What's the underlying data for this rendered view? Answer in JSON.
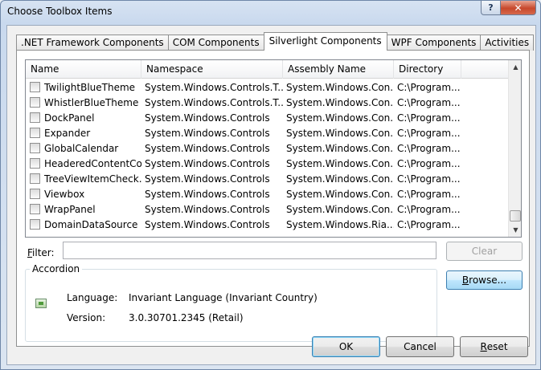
{
  "window": {
    "title": "Choose Toolbox Items",
    "help_label": "?",
    "close_label": "✕"
  },
  "tabs": [
    {
      "label": ".NET Framework Components",
      "active": false
    },
    {
      "label": "COM Components",
      "active": false
    },
    {
      "label": "Silverlight Components",
      "active": true
    },
    {
      "label": "WPF Components",
      "active": false
    },
    {
      "label": "Activities",
      "active": false
    }
  ],
  "list": {
    "columns": [
      "Name",
      "Namespace",
      "Assembly Name",
      "Directory"
    ],
    "rows": [
      {
        "name": "TwilightBlueTheme",
        "namespace": "System.Windows.Controls.T...",
        "assembly": "System.Windows.Con...",
        "directory": "C:\\Program...",
        "checked": false
      },
      {
        "name": "WhistlerBlueTheme",
        "namespace": "System.Windows.Controls.T...",
        "assembly": "System.Windows.Con...",
        "directory": "C:\\Program...",
        "checked": false
      },
      {
        "name": "DockPanel",
        "namespace": "System.Windows.Controls",
        "assembly": "System.Windows.Con...",
        "directory": "C:\\Program...",
        "checked": false
      },
      {
        "name": "Expander",
        "namespace": "System.Windows.Controls",
        "assembly": "System.Windows.Con...",
        "directory": "C:\\Program...",
        "checked": false
      },
      {
        "name": "GlobalCalendar",
        "namespace": "System.Windows.Controls",
        "assembly": "System.Windows.Con...",
        "directory": "C:\\Program...",
        "checked": false
      },
      {
        "name": "HeaderedContentCo...",
        "namespace": "System.Windows.Controls",
        "assembly": "System.Windows.Con...",
        "directory": "C:\\Program...",
        "checked": false
      },
      {
        "name": "TreeViewItemCheck...",
        "namespace": "System.Windows.Controls",
        "assembly": "System.Windows.Con...",
        "directory": "C:\\Program...",
        "checked": false
      },
      {
        "name": "Viewbox",
        "namespace": "System.Windows.Controls",
        "assembly": "System.Windows.Con...",
        "directory": "C:\\Program...",
        "checked": false
      },
      {
        "name": "WrapPanel",
        "namespace": "System.Windows.Controls",
        "assembly": "System.Windows.Con...",
        "directory": "C:\\Program...",
        "checked": false
      },
      {
        "name": "DomainDataSource",
        "namespace": "System.Windows.Controls",
        "assembly": "System.Windows.Ria....",
        "directory": "C:\\Program...",
        "checked": false
      }
    ],
    "scroll_up_icon": "triangle-up-icon",
    "scroll_down_icon": "triangle-down-icon"
  },
  "filter": {
    "label_accel": "F",
    "label_rest": "ilter:",
    "value": "",
    "clear_label": "Clear"
  },
  "browse": {
    "label_accel": "B",
    "label_rest": "rowse..."
  },
  "info": {
    "group_title": "Accordion",
    "icon": "assembly-icon",
    "language_label": "Language:",
    "language_value": "Invariant Language (Invariant Country)",
    "version_label": "Version:",
    "version_value": "3.0.30701.2345 (Retail)"
  },
  "footer": {
    "ok_label": "OK",
    "cancel_label": "Cancel",
    "reset_accel": "R",
    "reset_rest": "eset"
  },
  "colors": {
    "accent": "#3c7fb1",
    "close_button": "#c7482c"
  }
}
